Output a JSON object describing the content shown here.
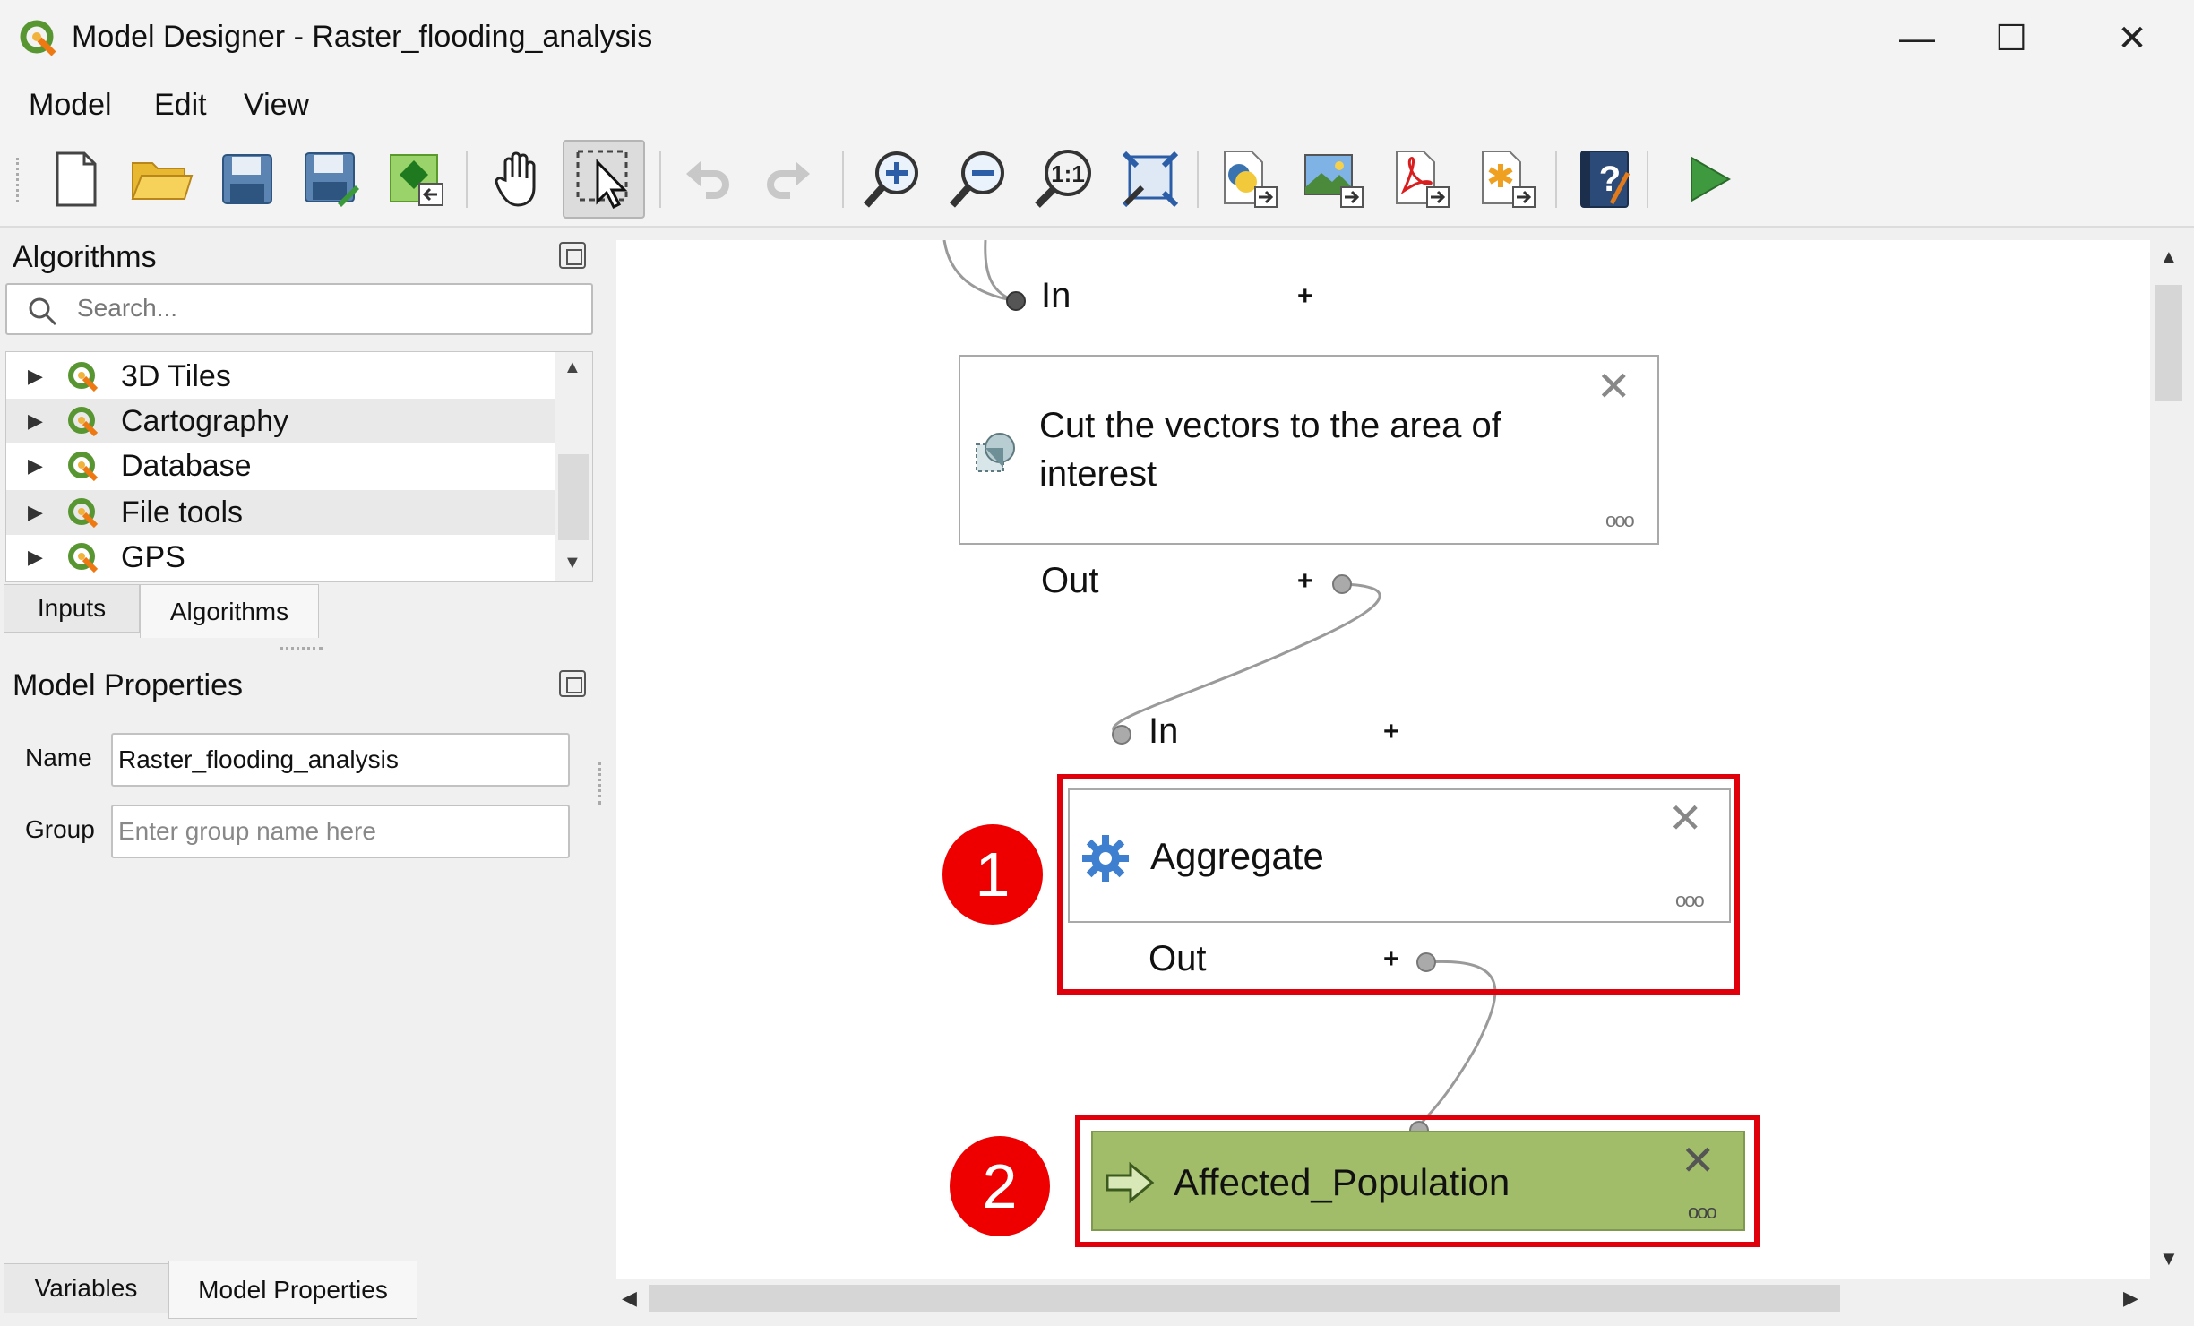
{
  "window": {
    "title": "Model Designer - Raster_flooding_analysis",
    "minimize_glyph": "—",
    "maximize_glyph": "☐",
    "close_glyph": "✕"
  },
  "menu": {
    "items": [
      "Model",
      "Edit",
      "View"
    ]
  },
  "toolbar": {
    "buttons": [
      "new-model-icon",
      "open-model-icon",
      "save-model-icon",
      "save-as-icon",
      "save-in-project-icon",
      "pan-icon",
      "select-icon",
      "undo-icon",
      "redo-icon",
      "zoom-in-icon",
      "zoom-out-icon",
      "zoom-actual-icon",
      "zoom-full-icon",
      "export-python-icon",
      "export-image-icon",
      "export-pdf-icon",
      "export-svg-icon",
      "help-icon",
      "run-icon"
    ]
  },
  "algorithms_panel": {
    "title": "Algorithms",
    "search_placeholder": "Search...",
    "items": [
      "3D Tiles",
      "Cartography",
      "Database",
      "File tools",
      "GPS"
    ],
    "tabs": [
      "Inputs",
      "Algorithms"
    ]
  },
  "model_properties": {
    "title": "Model Properties",
    "name_label": "Name",
    "name_value": "Raster_flooding_analysis",
    "group_label": "Group",
    "group_placeholder": "Enter group name here"
  },
  "bottom_tabs": [
    "Variables",
    "Model Properties"
  ],
  "canvas": {
    "top_in_label": "In",
    "cut_box_label_line1": "Cut the vectors to the area of",
    "cut_box_label_line2": "interest",
    "cut_out_label": "Out",
    "aggregate_in_label": "In",
    "aggregate_label": "Aggregate",
    "aggregate_out_label": "Out",
    "output_label": "Affected_Population",
    "badge1": "1",
    "badge2": "2",
    "plus": "+",
    "x_glyph": "✕",
    "dots_glyph": "ooo"
  },
  "colors": {
    "highlight_red": "#e0000c",
    "output_green": "#a1bd6a",
    "gear_blue": "#3f7fcf"
  }
}
